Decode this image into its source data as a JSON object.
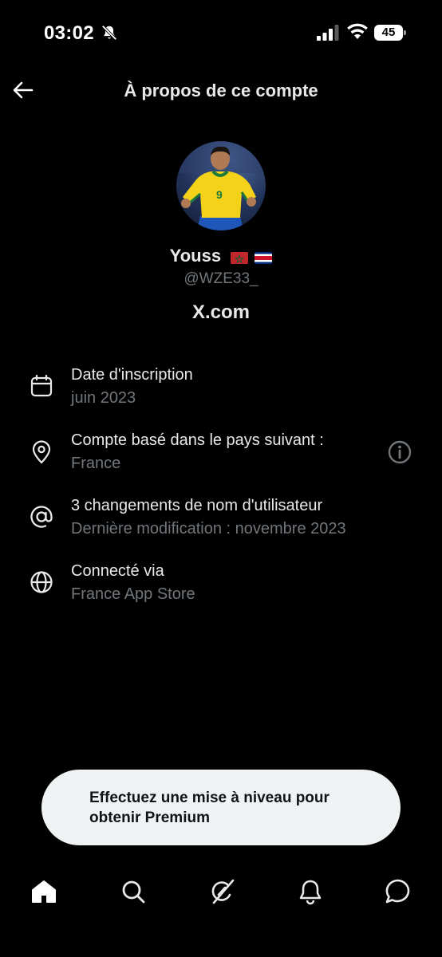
{
  "status_bar": {
    "time": "03:02",
    "battery_percent": "45",
    "icons": [
      "bell-off-icon",
      "signal-icon",
      "wifi-icon",
      "battery-icon"
    ]
  },
  "header": {
    "title": "À propos de ce compte",
    "back_icon": "arrow-left-icon"
  },
  "profile": {
    "avatar_icon": "avatar",
    "display_name": "Youss",
    "flags": [
      "morocco-flag",
      "costa-rica-flag"
    ],
    "handle": "@WZE33_",
    "site": "X.com"
  },
  "info": [
    {
      "icon": "calendar-icon",
      "label": "Date d'inscription",
      "value": "juin 2023"
    },
    {
      "icon": "location-pin-icon",
      "label": "Compte basé dans le pays suivant :",
      "value": "France",
      "action_icon": "info-icon"
    },
    {
      "icon": "at-sign-icon",
      "label": "3 changements de nom d'utilisateur",
      "value": "Dernière modification : novembre 2023"
    },
    {
      "icon": "globe-icon",
      "label": "Connecté via",
      "value": "France App Store"
    }
  ],
  "premium_banner": {
    "text": "Effectuez une mise à niveau pour obtenir Premium"
  },
  "bottom_nav": [
    "home-icon",
    "search-icon",
    "grok-icon",
    "bell-icon",
    "messages-icon"
  ],
  "colors": {
    "background": "#000000",
    "primary_text": "#e7e9ea",
    "secondary_text": "#71767b",
    "banner_bg": "#eff3f4"
  }
}
